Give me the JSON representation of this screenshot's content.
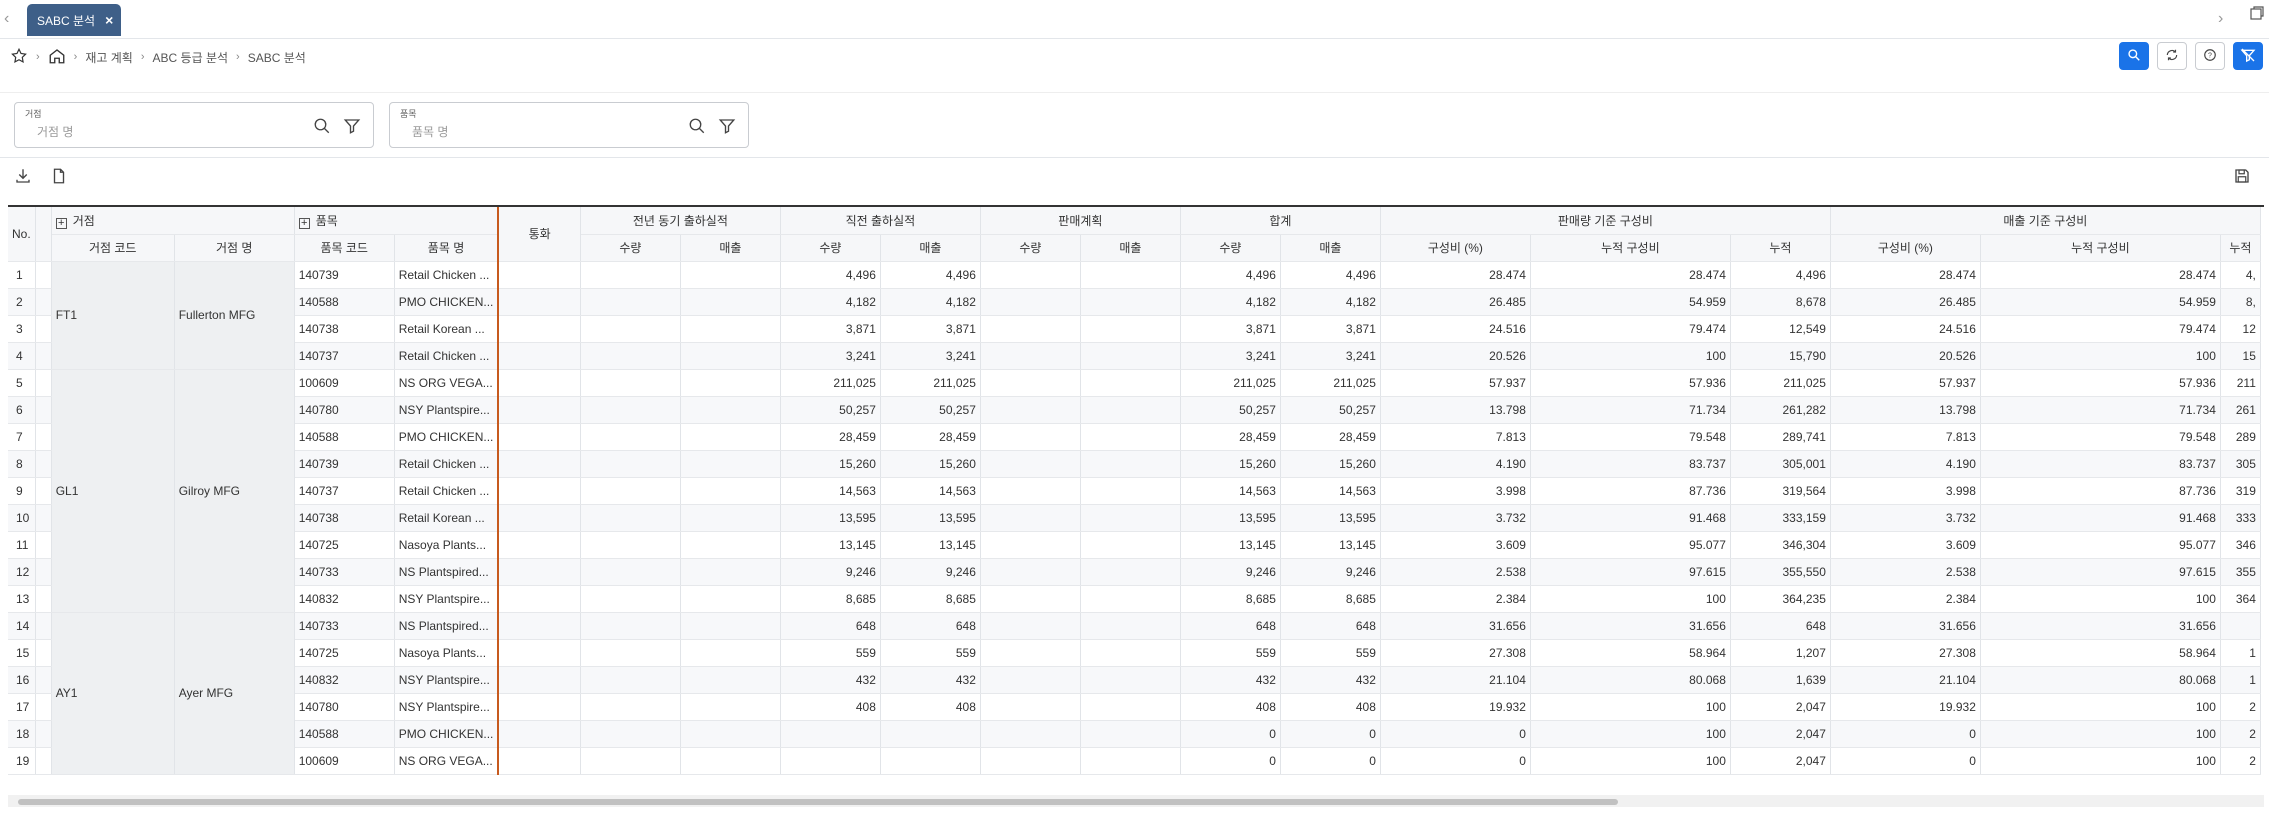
{
  "tabs": [
    {
      "label": "SABC 분석"
    }
  ],
  "breadcrumb": [
    "재고 계획",
    "ABC 등급 분석",
    "SABC 분석"
  ],
  "filters": [
    {
      "label": "거점",
      "placeholder": "거점 명"
    },
    {
      "label": "품목",
      "placeholder": "품목 명"
    }
  ],
  "colors": {
    "accent": "#1a73e8",
    "tab": "#3e5f88",
    "freeze_line": "#c75a1e"
  },
  "table": {
    "no_header": "No.",
    "group_site": "거점",
    "group_item": "품목",
    "col_site_code": "거점 코드",
    "col_site_name": "거점 명",
    "col_item_code": "품목 코드",
    "col_item_name": "품목 명",
    "col_currency": "통화",
    "groups": [
      "전년 동기 출하실적",
      "직전 출하실적",
      "판매계획",
      "합계",
      "판매량 기준 구성비",
      "매출 기준 구성비"
    ],
    "qty": "수량",
    "sales": "매출",
    "ratio": "구성비 (%)",
    "cum_ratio": "누적 구성비",
    "cum": "누적",
    "sites": [
      {
        "code": "FT1",
        "name": "Fullerton MFG"
      },
      {
        "code": "GL1",
        "name": "Gilroy MFG"
      },
      {
        "code": "AY1",
        "name": "Ayer MFG"
      }
    ],
    "rows": [
      {
        "no": "1",
        "item_code": "140739",
        "item_name": "Retail Chicken ...",
        "q2": "4,496",
        "s2": "4,496",
        "qt": "4,496",
        "st": "4,496",
        "r1": "28.474",
        "c1": "28.474",
        "n1": "4,496",
        "r2": "28.474",
        "c2": "28.474",
        "n2": "4,"
      },
      {
        "no": "2",
        "item_code": "140588",
        "item_name": "PMO CHICKEN...",
        "q2": "4,182",
        "s2": "4,182",
        "qt": "4,182",
        "st": "4,182",
        "r1": "26.485",
        "c1": "54.959",
        "n1": "8,678",
        "r2": "26.485",
        "c2": "54.959",
        "n2": "8,"
      },
      {
        "no": "3",
        "item_code": "140738",
        "item_name": "Retail Korean ...",
        "q2": "3,871",
        "s2": "3,871",
        "qt": "3,871",
        "st": "3,871",
        "r1": "24.516",
        "c1": "79.474",
        "n1": "12,549",
        "r2": "24.516",
        "c2": "79.474",
        "n2": "12"
      },
      {
        "no": "4",
        "item_code": "140737",
        "item_name": "Retail Chicken ...",
        "q2": "3,241",
        "s2": "3,241",
        "qt": "3,241",
        "st": "3,241",
        "r1": "20.526",
        "c1": "100",
        "n1": "15,790",
        "r2": "20.526",
        "c2": "100",
        "n2": "15"
      },
      {
        "no": "5",
        "item_code": "100609",
        "item_name": "NS ORG VEGA...",
        "q2": "211,025",
        "s2": "211,025",
        "qt": "211,025",
        "st": "211,025",
        "r1": "57.937",
        "c1": "57.936",
        "n1": "211,025",
        "r2": "57.937",
        "c2": "57.936",
        "n2": "211"
      },
      {
        "no": "6",
        "item_code": "140780",
        "item_name": "NSY Plantspire...",
        "q2": "50,257",
        "s2": "50,257",
        "qt": "50,257",
        "st": "50,257",
        "r1": "13.798",
        "c1": "71.734",
        "n1": "261,282",
        "r2": "13.798",
        "c2": "71.734",
        "n2": "261"
      },
      {
        "no": "7",
        "item_code": "140588",
        "item_name": "PMO CHICKEN...",
        "q2": "28,459",
        "s2": "28,459",
        "qt": "28,459",
        "st": "28,459",
        "r1": "7.813",
        "c1": "79.548",
        "n1": "289,741",
        "r2": "7.813",
        "c2": "79.548",
        "n2": "289"
      },
      {
        "no": "8",
        "item_code": "140739",
        "item_name": "Retail Chicken ...",
        "q2": "15,260",
        "s2": "15,260",
        "qt": "15,260",
        "st": "15,260",
        "r1": "4.190",
        "c1": "83.737",
        "n1": "305,001",
        "r2": "4.190",
        "c2": "83.737",
        "n2": "305"
      },
      {
        "no": "9",
        "item_code": "140737",
        "item_name": "Retail Chicken ...",
        "q2": "14,563",
        "s2": "14,563",
        "qt": "14,563",
        "st": "14,563",
        "r1": "3.998",
        "c1": "87.736",
        "n1": "319,564",
        "r2": "3.998",
        "c2": "87.736",
        "n2": "319"
      },
      {
        "no": "10",
        "item_code": "140738",
        "item_name": "Retail Korean ...",
        "q2": "13,595",
        "s2": "13,595",
        "qt": "13,595",
        "st": "13,595",
        "r1": "3.732",
        "c1": "91.468",
        "n1": "333,159",
        "r2": "3.732",
        "c2": "91.468",
        "n2": "333"
      },
      {
        "no": "11",
        "item_code": "140725",
        "item_name": "Nasoya Plants...",
        "q2": "13,145",
        "s2": "13,145",
        "qt": "13,145",
        "st": "13,145",
        "r1": "3.609",
        "c1": "95.077",
        "n1": "346,304",
        "r2": "3.609",
        "c2": "95.077",
        "n2": "346"
      },
      {
        "no": "12",
        "item_code": "140733",
        "item_name": "NS Plantspired...",
        "q2": "9,246",
        "s2": "9,246",
        "qt": "9,246",
        "st": "9,246",
        "r1": "2.538",
        "c1": "97.615",
        "n1": "355,550",
        "r2": "2.538",
        "c2": "97.615",
        "n2": "355"
      },
      {
        "no": "13",
        "item_code": "140832",
        "item_name": "NSY Plantspire...",
        "q2": "8,685",
        "s2": "8,685",
        "qt": "8,685",
        "st": "8,685",
        "r1": "2.384",
        "c1": "100",
        "n1": "364,235",
        "r2": "2.384",
        "c2": "100",
        "n2": "364"
      },
      {
        "no": "14",
        "item_code": "140733",
        "item_name": "NS Plantspired...",
        "q2": "648",
        "s2": "648",
        "qt": "648",
        "st": "648",
        "r1": "31.656",
        "c1": "31.656",
        "n1": "648",
        "r2": "31.656",
        "c2": "31.656",
        "n2": ""
      },
      {
        "no": "15",
        "item_code": "140725",
        "item_name": "Nasoya Plants...",
        "q2": "559",
        "s2": "559",
        "qt": "559",
        "st": "559",
        "r1": "27.308",
        "c1": "58.964",
        "n1": "1,207",
        "r2": "27.308",
        "c2": "58.964",
        "n2": "1"
      },
      {
        "no": "16",
        "item_code": "140832",
        "item_name": "NSY Plantspire...",
        "q2": "432",
        "s2": "432",
        "qt": "432",
        "st": "432",
        "r1": "21.104",
        "c1": "80.068",
        "n1": "1,639",
        "r2": "21.104",
        "c2": "80.068",
        "n2": "1"
      },
      {
        "no": "17",
        "item_code": "140780",
        "item_name": "NSY Plantspire...",
        "q2": "408",
        "s2": "408",
        "qt": "408",
        "st": "408",
        "r1": "19.932",
        "c1": "100",
        "n1": "2,047",
        "r2": "19.932",
        "c2": "100",
        "n2": "2"
      },
      {
        "no": "18",
        "item_code": "140588",
        "item_name": "PMO CHICKEN...",
        "q2": "",
        "s2": "",
        "qt": "0",
        "st": "0",
        "r1": "0",
        "c1": "100",
        "n1": "2,047",
        "r2": "0",
        "c2": "100",
        "n2": "2"
      },
      {
        "no": "19",
        "item_code": "100609",
        "item_name": "NS ORG VEGA...",
        "q2": "",
        "s2": "",
        "qt": "0",
        "st": "0",
        "r1": "0",
        "c1": "100",
        "n1": "2,047",
        "r2": "0",
        "c2": "100",
        "n2": "2"
      }
    ]
  }
}
